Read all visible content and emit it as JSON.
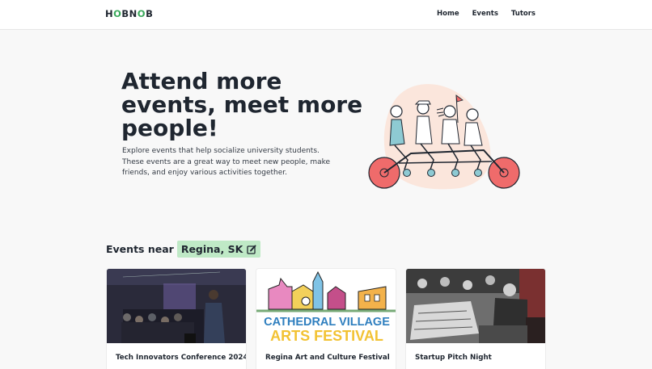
{
  "brand": {
    "name_parts": [
      "H",
      "O",
      "BN",
      "O",
      "B"
    ],
    "accent": "#3aa95b"
  },
  "nav": {
    "items": [
      {
        "label": "Home"
      },
      {
        "label": "Events"
      },
      {
        "label": "Tutors"
      }
    ]
  },
  "hero": {
    "title": "Attend more events, meet more people!",
    "subtitle": "Explore events that help socialize university students. These events are a great way to meet new people, make friends, and enjoy various activities together.",
    "illustration": "tandem-bicycle-illustration"
  },
  "events_section": {
    "heading": "Events near",
    "location": "Regina, SK",
    "location_icon": "edit-icon",
    "chip_color": "#bfe9c6"
  },
  "events": [
    {
      "title": "Tech Innovators Conference 2024",
      "image": "conference-speaker-photo"
    },
    {
      "title": "Regina Art and Culture Festival",
      "image": "cathedral-village-arts-festival-poster",
      "poster_line1": "CATHEDRAL VILLAGE",
      "poster_line2": "ARTS FESTIVAL"
    },
    {
      "title": "Startup Pitch Night",
      "image": "vintage-office-photo"
    }
  ]
}
